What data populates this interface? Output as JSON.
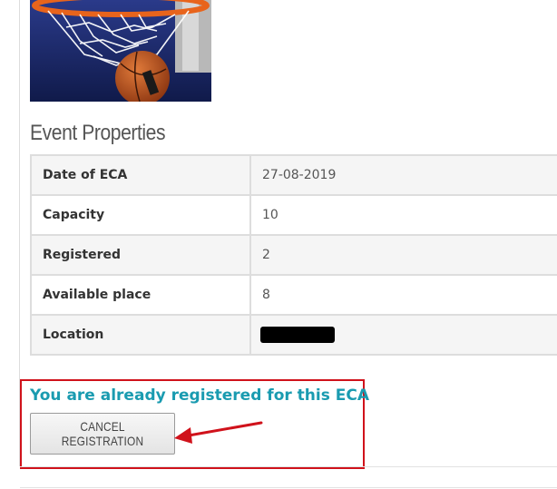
{
  "event_image": {
    "icon": "basketball-hoop-photo",
    "colors": {
      "background": "#1a2a6a",
      "ball": "#c75a1e",
      "rim": "#e8641c",
      "net": "#ffffff"
    }
  },
  "properties": {
    "title": "Event Properties",
    "rows": [
      {
        "label": "Date of ECA",
        "value": "27-08-2019"
      },
      {
        "label": "Capacity",
        "value": "10"
      },
      {
        "label": "Registered",
        "value": "2"
      },
      {
        "label": "Available place",
        "value": "8"
      },
      {
        "label": "Location",
        "value": ""
      }
    ]
  },
  "registration": {
    "message": "You are already registered for this ECA",
    "cancel_label": "CANCEL REGISTRATION",
    "colors": {
      "message": "#1a9bb0",
      "highlight": "#d0121b",
      "arrow": "#d0121b"
    }
  }
}
